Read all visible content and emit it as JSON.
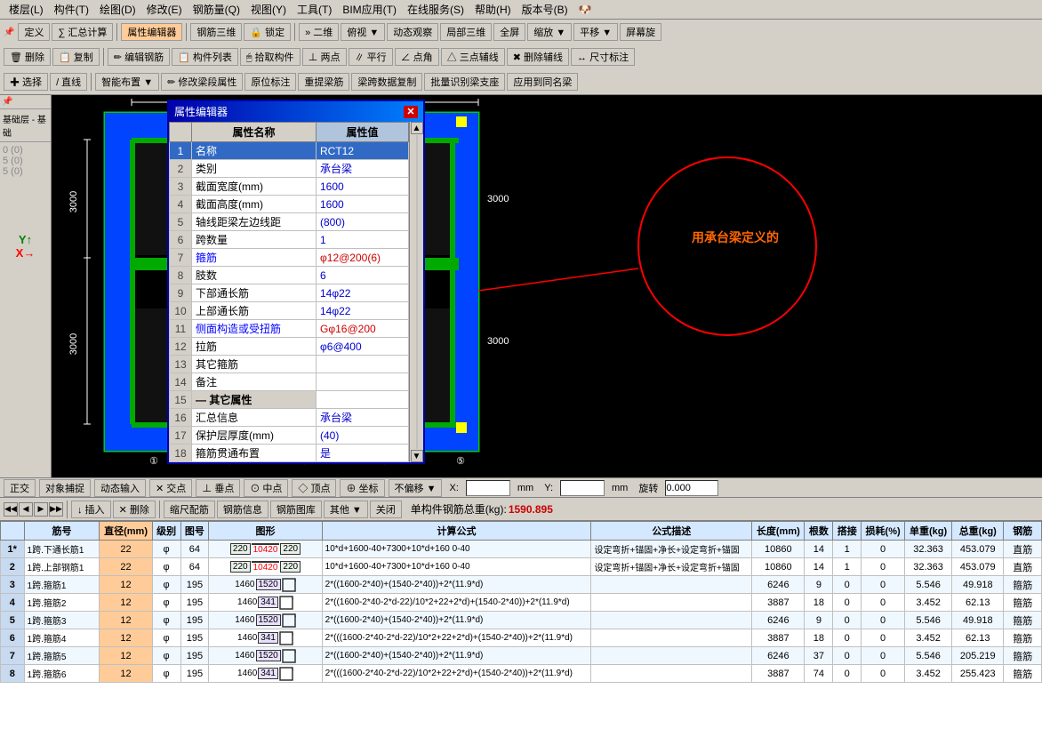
{
  "menubar": {
    "items": [
      "楼层(L)",
      "构件(T)",
      "绘图(D)",
      "修改(E)",
      "钢筋量(Q)",
      "视图(Y)",
      "工具(T)",
      "BIM应用(T)",
      "在线服务(S)",
      "帮助(H)",
      "版本号(B)"
    ]
  },
  "toolbar": {
    "row1": {
      "items": [
        "定义",
        "∑汇总计算",
        "属性编辑器",
        "钢筋三维",
        "锁定",
        "二维",
        "俯视",
        "动态观察",
        "局部三维",
        "全屏",
        "缩放",
        "平移",
        "屏幕旋"
      ]
    },
    "row2": {
      "items": [
        "删除",
        "复制",
        "编辑钢筋",
        "构件列表",
        "拾取构件",
        "两点",
        "平行",
        "点角",
        "三点辅线",
        "删除辅线",
        "尺寸标注"
      ]
    },
    "row3": {
      "items": [
        "选择",
        "直线",
        "智能布置",
        "修改梁段属性",
        "原位标注",
        "重提梁筋",
        "梁跨数据复制",
        "批量识别梁支座",
        "应用到同名梁"
      ]
    }
  },
  "layer_panel": {
    "title": "基础层 - 基础",
    "items": [
      "基础层",
      "基础"
    ]
  },
  "dialog": {
    "title": "属性编辑器",
    "col1": "属性名称",
    "col2": "属性值",
    "rows": [
      {
        "id": 1,
        "name": "名称",
        "value": "RCT12",
        "selected": true
      },
      {
        "id": 2,
        "name": "类别",
        "value": "承台梁",
        "selected": false
      },
      {
        "id": 3,
        "name": "截面宽度(mm)",
        "value": "1600",
        "selected": false
      },
      {
        "id": 4,
        "name": "截面高度(mm)",
        "value": "1600",
        "selected": false
      },
      {
        "id": 5,
        "name": "轴线距梁左边线距",
        "value": "(800)",
        "selected": false
      },
      {
        "id": 6,
        "name": "跨数量",
        "value": "1",
        "selected": false
      },
      {
        "id": 7,
        "name": "箍筋",
        "value": "φ12@200(6)",
        "selected": false,
        "highlight": true
      },
      {
        "id": 8,
        "name": "肢数",
        "value": "6",
        "selected": false
      },
      {
        "id": 9,
        "name": "下部通长筋",
        "value": "14φ22",
        "selected": false
      },
      {
        "id": 10,
        "name": "上部通长筋",
        "value": "14φ22",
        "selected": false
      },
      {
        "id": 11,
        "name": "侧面构造或受扭筋",
        "value": "Gφ16@200",
        "selected": false,
        "highlight": true
      },
      {
        "id": 12,
        "name": "拉筋",
        "value": "φ6@400",
        "selected": false
      },
      {
        "id": 13,
        "name": "其它箍筋",
        "value": "",
        "selected": false
      },
      {
        "id": 14,
        "name": "备注",
        "value": "",
        "selected": false
      },
      {
        "id": 15,
        "name": "— 其它属性",
        "value": "",
        "selected": false,
        "group": true
      },
      {
        "id": 16,
        "name": "汇总信息",
        "value": "承台梁",
        "selected": false
      },
      {
        "id": 17,
        "name": "保护层厚度(mm)",
        "value": "(40)",
        "selected": false
      },
      {
        "id": 18,
        "name": "箍筋贯通布置",
        "value": "是",
        "selected": false
      }
    ]
  },
  "cad": {
    "annotation": "用承台梁定义的"
  },
  "bottom_toolbar": {
    "items": [
      "正交",
      "对象捕捉",
      "动态输入",
      "交点",
      "垂点",
      "中点",
      "顶点",
      "坐标",
      "不偏移"
    ],
    "x_label": "X:",
    "y_label": "Y:",
    "mm_label": "mm",
    "rotate_label": "旋转",
    "rotate_value": "0.000"
  },
  "rebar_toolbar": {
    "nav_buttons": [
      "◀◀",
      "◀",
      "▶",
      "▶▶"
    ],
    "buttons": [
      "插入",
      "删除",
      "缩尺配筋",
      "钢筋信息",
      "钢筋图库",
      "其他",
      "关闭"
    ],
    "total_label": "单构件钢筋总重(kg):",
    "total_value": "1590.895"
  },
  "rebar_table": {
    "headers": [
      "筋号",
      "直径(mm)",
      "级别",
      "图号",
      "图形",
      "计算公式",
      "公式描述",
      "长度(mm)",
      "根数",
      "搭接",
      "损耗(%)",
      "单重(kg)",
      "总重(kg)",
      "钢筋"
    ],
    "rows": [
      {
        "id": "1*",
        "name": "1跨.下通长筋1",
        "diameter": "22",
        "grade": "φ",
        "fig_no": "64",
        "shape_dims": [
          "220",
          "10420",
          "220"
        ],
        "formula": "10*d+1600-40+7300+10*d+160 0-40",
        "description": "设定弯折+锚固+净长+设定弯折+锚固",
        "length": "10860",
        "count": "14",
        "overlap": "1",
        "loss": "0",
        "unit_weight": "32.363",
        "total_weight": "453.079",
        "type": "直筋"
      },
      {
        "id": "2",
        "name": "1跨.上部钢筋1",
        "diameter": "22",
        "grade": "φ",
        "fig_no": "64",
        "shape_dims": [
          "220",
          "10420",
          "220"
        ],
        "formula": "10*d+1600-40+7300+10*d+160 0-40",
        "description": "设定弯折+锚固+净长+设定弯折+锚固",
        "length": "10860",
        "count": "14",
        "overlap": "1",
        "loss": "0",
        "unit_weight": "32.363",
        "total_weight": "453.079",
        "type": "直筋"
      },
      {
        "id": "3",
        "name": "1跨.箍筋1",
        "diameter": "12",
        "grade": "φ",
        "fig_no": "195",
        "shape_dims_l": "1460",
        "shape_val": "1520",
        "formula": "2*((1600-2*40)+(1540-2*40))+2*(11.9*d)",
        "description": "",
        "length": "6246",
        "count": "9",
        "overlap": "0",
        "loss": "0",
        "unit_weight": "5.546",
        "total_weight": "49.918",
        "type": "箍筋"
      },
      {
        "id": "4",
        "name": "1跨.箍筋2",
        "diameter": "12",
        "grade": "φ",
        "fig_no": "195",
        "shape_dims_l": "1460",
        "shape_val": "341",
        "formula": "2*((1600-2*40-2*d-22)/10*2+22+2*d)+(1540-2*40))+2*(11.9*d)",
        "description": "",
        "length": "3887",
        "count": "18",
        "overlap": "0",
        "loss": "0",
        "unit_weight": "3.452",
        "total_weight": "62.13",
        "type": "箍筋"
      },
      {
        "id": "5",
        "name": "1跨.箍筋3",
        "diameter": "12",
        "grade": "φ",
        "fig_no": "195",
        "shape_dims_l": "1460",
        "shape_val": "1520",
        "formula": "2*((1600-2*40)+(1540-2*40))+2*(11.9*d)",
        "description": "",
        "length": "6246",
        "count": "9",
        "overlap": "0",
        "loss": "0",
        "unit_weight": "5.546",
        "total_weight": "49.918",
        "type": "箍筋"
      },
      {
        "id": "6",
        "name": "1跨.箍筋4",
        "diameter": "12",
        "grade": "φ",
        "fig_no": "195",
        "shape_dims_l": "1460",
        "shape_val": "341",
        "formula": "2*(((1600-2*40-2*d-22)/10*2+22+2*d)+(1540-2*40))+2*(11.9*d)",
        "description": "",
        "length": "3887",
        "count": "18",
        "overlap": "0",
        "loss": "0",
        "unit_weight": "3.452",
        "total_weight": "62.13",
        "type": "箍筋"
      },
      {
        "id": "7",
        "name": "1跨.箍筋5",
        "diameter": "12",
        "grade": "φ",
        "fig_no": "195",
        "shape_dims_l": "1460",
        "shape_val": "1520",
        "formula": "2*((1600-2*40)+(1540-2*40))+2*(11.9*d)",
        "description": "",
        "length": "6246",
        "count": "37",
        "overlap": "0",
        "loss": "0",
        "unit_weight": "5.546",
        "total_weight": "205.219",
        "type": "箍筋"
      },
      {
        "id": "8",
        "name": "1跨.箍筋6",
        "diameter": "12",
        "grade": "φ",
        "fig_no": "195",
        "shape_dims_l": "1460",
        "shape_val": "341",
        "formula": "2*(((1600-2*40-2*d-22)/10*2+22+2*d)+(1540-2*40))+2*(11.9*d)",
        "description": "",
        "length": "3887",
        "count": "74",
        "overlap": "0",
        "loss": "0",
        "unit_weight": "3.452",
        "total_weight": "255.423",
        "type": "箍筋"
      }
    ]
  }
}
